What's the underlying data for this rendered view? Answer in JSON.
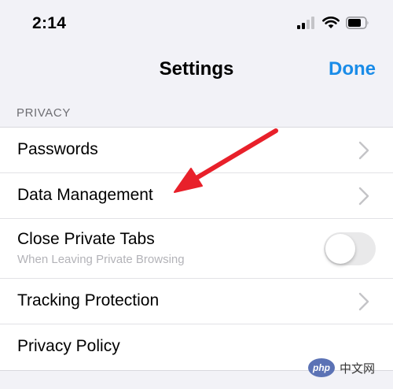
{
  "status_bar": {
    "time": "2:14"
  },
  "nav": {
    "title": "Settings",
    "done_label": "Done"
  },
  "section": {
    "header": "PRIVACY"
  },
  "rows": [
    {
      "label": "Passwords",
      "accessory": "chevron-right-icon"
    },
    {
      "label": "Data Management",
      "accessory": "chevron-right-icon"
    },
    {
      "label": "Close Private Tabs",
      "sublabel": "When Leaving Private Browsing",
      "toggle_on": false
    },
    {
      "label": "Tracking Protection",
      "accessory": "chevron-right-icon"
    },
    {
      "label": "Privacy Policy"
    }
  ],
  "colors": {
    "accent": "#1a8ce8",
    "annotation_arrow": "#e8202a",
    "background": "#f2f2f7"
  },
  "watermark": {
    "badge": "php",
    "text": "中文网"
  }
}
